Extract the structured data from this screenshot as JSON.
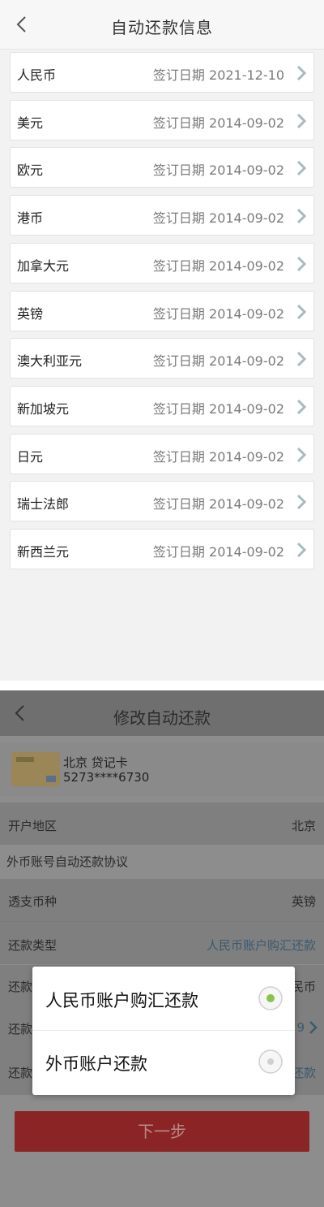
{
  "screen1": {
    "title": "自动还款信息",
    "rows": [
      {
        "name": "人民币",
        "date": "签订日期 2021-12-10"
      },
      {
        "name": "美元",
        "date": "签订日期 2014-09-02"
      },
      {
        "name": "欧元",
        "date": "签订日期 2014-09-02"
      },
      {
        "name": "港币",
        "date": "签订日期 2014-09-02"
      },
      {
        "name": "加拿大元",
        "date": "签订日期 2014-09-02"
      },
      {
        "name": "英镑",
        "date": "签订日期 2014-09-02"
      },
      {
        "name": "澳大利亚元",
        "date": "签订日期 2014-09-02"
      },
      {
        "name": "新加坡元",
        "date": "签订日期 2014-09-02"
      },
      {
        "name": "日元",
        "date": "签订日期 2014-09-02"
      },
      {
        "name": "瑞士法郎",
        "date": "签订日期 2014-09-02"
      },
      {
        "name": "新西兰元",
        "date": "签订日期 2014-09-02"
      }
    ],
    "chevron_icon": "chevron-right-icon",
    "back_icon": "back-arrow-icon"
  },
  "screen2": {
    "title": "修改自动还款",
    "card": {
      "name": "北京 贷记卡",
      "number": "5273****6730"
    },
    "open_region_label": "开户地区",
    "open_region_value": "北京",
    "section_title": "外币账号自动还款协议",
    "overdraft_currency_label": "透支币种",
    "overdraft_currency_value": "英镑",
    "repay_type_label": "还款类型",
    "repay_type_value": "人民币账户购汇还款",
    "row5_label_partial": "还款",
    "row5_value_partial": "民币",
    "row6_label_partial": "还款",
    "row6_value_partial": "9",
    "row7_label_partial": "还款",
    "row7_value_partial": "还款",
    "dialog": {
      "option1": "人民币账户购汇还款",
      "option2": "外币账户还款",
      "selected_index": 0
    },
    "next_button": "下一步"
  },
  "colors": {
    "accent_green": "#8bc34a",
    "chevron": "#a9b9c0",
    "link": "#3a5a70",
    "next_button_bg": "#8b2525"
  }
}
